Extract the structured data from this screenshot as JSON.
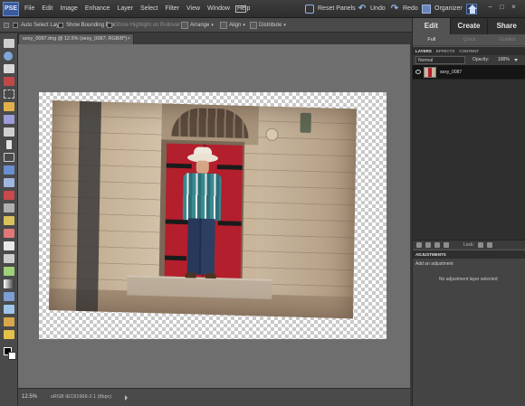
{
  "app": {
    "logo_text": "PSE"
  },
  "menu": {
    "items": [
      "File",
      "Edit",
      "Image",
      "Enhance",
      "Layer",
      "Select",
      "Filter",
      "View",
      "Window",
      "Help"
    ],
    "reset_panels": "Reset Panels",
    "undo": "Undo",
    "redo": "Redo",
    "organizer": "Organizer"
  },
  "options_bar": {
    "auto_select_layer": "Auto Select Layer",
    "show_bounding_box": "Show Bounding Box",
    "show_highlight": "Show Highlight on Rollover",
    "arrange": "Arrange",
    "align": "Align",
    "distribute": "Distribute"
  },
  "document": {
    "tab_title": "sexy_0087.dng @ 12.5% (sexy_0087, RGB/8*)",
    "close_glyph": "×"
  },
  "status_bar": {
    "zoom": "12.5%",
    "info": "sRGB IEC61966-2.1 (8bpc)"
  },
  "panel": {
    "mode_tabs": [
      "Edit",
      "Create",
      "Share"
    ],
    "sub_tabs": [
      "Full",
      "Quick",
      "Guided"
    ],
    "layer_tabs": [
      "LAYERS",
      "EFFECTS",
      "CONTENT"
    ],
    "blend_mode": "Normal",
    "opacity_label": "Opacity:",
    "opacity_value": "100%",
    "layer_name": "sexy_0087",
    "lock_label": "Lock:",
    "adjustments_title": "ADJUSTMENTS",
    "add_adjustment": "Add an adjustment",
    "no_adjustment": "No adjustment layer selected"
  },
  "colors": {
    "door_red": "#b31f2c",
    "ui_dark": "#3a3a3a",
    "workspace_gray": "#6e6e6e"
  },
  "icons": [
    "search-icon",
    "undo-icon",
    "redo-icon",
    "home-icon",
    "eye-icon"
  ]
}
